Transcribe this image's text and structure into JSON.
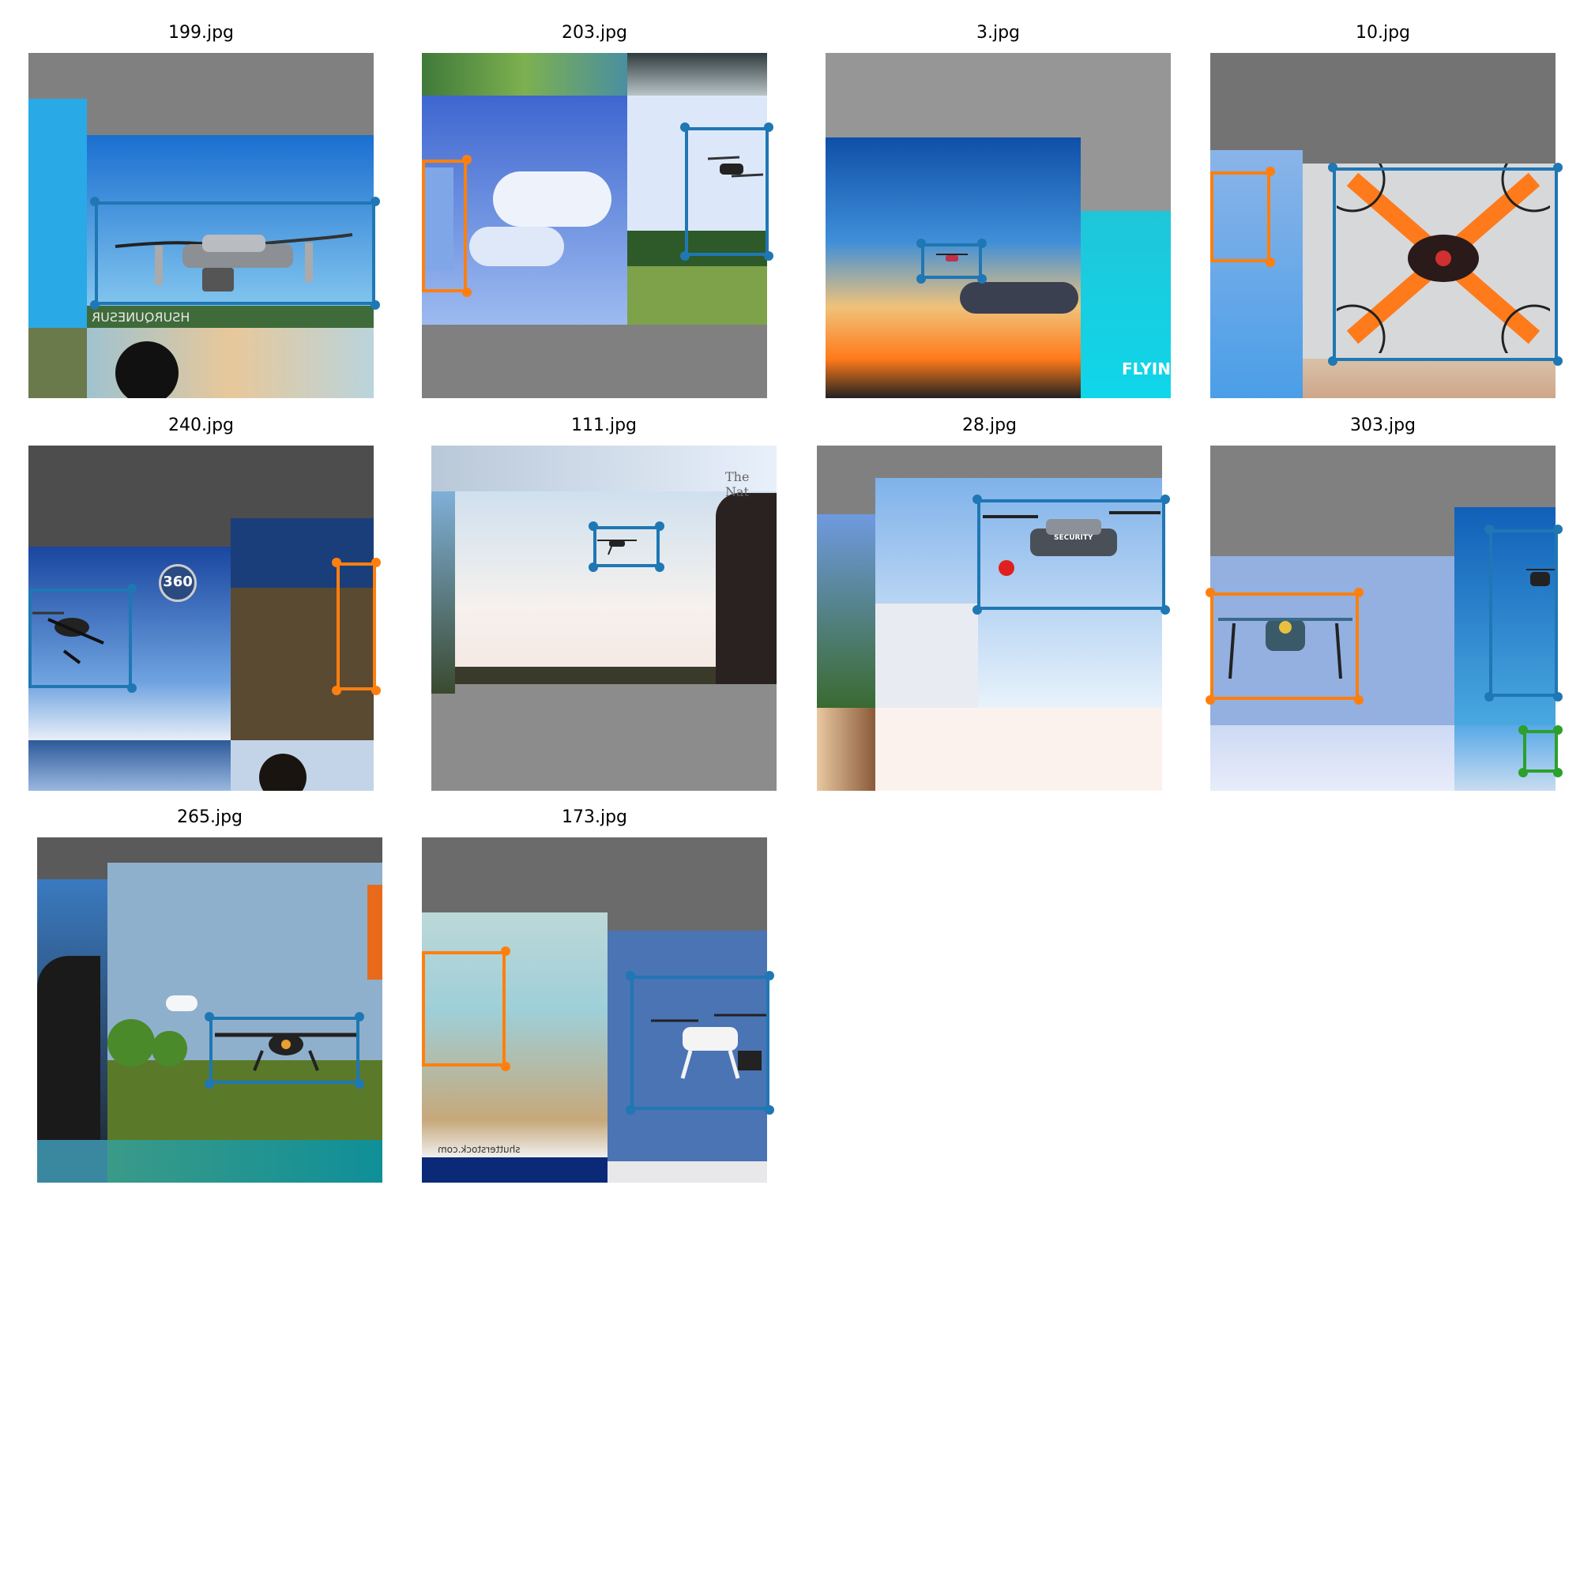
{
  "colors": {
    "box_blue": "#1f77b4",
    "box_orange": "#ff7f0e",
    "box_green": "#2ca02c"
  },
  "panels": [
    {
      "title": "199.jpg",
      "overlay_text": "HSURQUNESUR"
    },
    {
      "title": "203.jpg"
    },
    {
      "title": "3.jpg",
      "overlay_text": "FLYIN"
    },
    {
      "title": "10.jpg"
    },
    {
      "title": "240.jpg",
      "overlay_text": "360"
    },
    {
      "title": "111.jpg",
      "overlay_text": "The Nat"
    },
    {
      "title": "28.jpg",
      "overlay_text": "SECURITY"
    },
    {
      "title": "303.jpg"
    },
    {
      "title": "265.jpg"
    },
    {
      "title": "173.jpg",
      "overlay_text": "shutterstock.com"
    }
  ]
}
